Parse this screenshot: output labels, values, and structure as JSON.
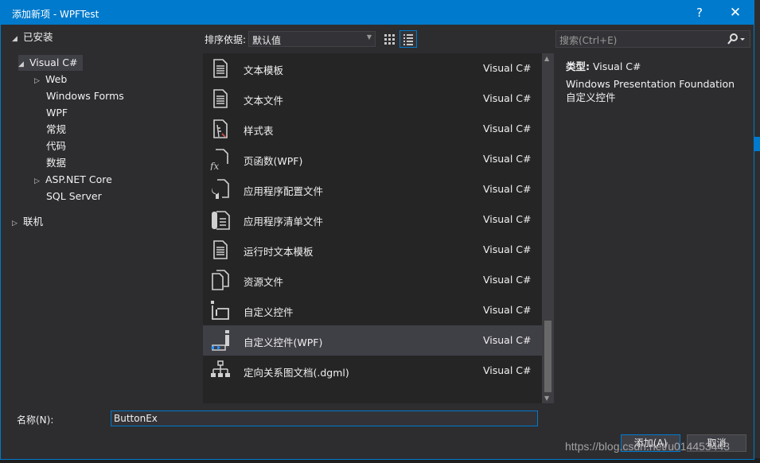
{
  "window": {
    "title": "添加新项 - WPFTest",
    "help": "?",
    "close": "✕"
  },
  "tree": {
    "installed": "已安装",
    "visual_csharp": "Visual C#",
    "web": "Web",
    "windows_forms": "Windows Forms",
    "wpf": "WPF",
    "general": "常规",
    "code": "代码",
    "data": "数据",
    "aspnet_core": "ASP.NET Core",
    "sql_server": "SQL Server",
    "online": "联机"
  },
  "toolbar": {
    "sort_label": "排序依据:",
    "sort_value": "默认值",
    "search_placeholder": "搜索(Ctrl+E)"
  },
  "items": [
    {
      "name": "文本模板",
      "lang": "Visual C#",
      "icon": "text-template-icon"
    },
    {
      "name": "文本文件",
      "lang": "Visual C#",
      "icon": "text-file-icon"
    },
    {
      "name": "样式表",
      "lang": "Visual C#",
      "icon": "stylesheet-icon"
    },
    {
      "name": "页函数(WPF)",
      "lang": "Visual C#",
      "icon": "page-function-icon"
    },
    {
      "name": "应用程序配置文件",
      "lang": "Visual C#",
      "icon": "config-file-icon"
    },
    {
      "name": "应用程序清单文件",
      "lang": "Visual C#",
      "icon": "manifest-file-icon"
    },
    {
      "name": "运行时文本模板",
      "lang": "Visual C#",
      "icon": "runtime-template-icon"
    },
    {
      "name": "资源文件",
      "lang": "Visual C#",
      "icon": "resource-file-icon"
    },
    {
      "name": "自定义控件",
      "lang": "Visual C#",
      "icon": "custom-control-icon"
    },
    {
      "name": "自定义控件(WPF)",
      "lang": "Visual C#",
      "icon": "wpf-custom-control-icon"
    },
    {
      "name": "定向关系图文档(.dgml)",
      "lang": "Visual C#",
      "icon": "dgml-icon"
    }
  ],
  "details": {
    "type_label": "类型:",
    "type_value": "Visual C#",
    "description": "Windows Presentation Foundation 自定义控件"
  },
  "name_field": {
    "label": "名称(N):",
    "value": "ButtonEx"
  },
  "buttons": {
    "add": "添加(A)",
    "cancel": "取消"
  },
  "watermark": "https://blog.csdn.net/u014453443",
  "colors": {
    "accent": "#007acc",
    "background": "#2d2d30",
    "list_background": "#252526",
    "selected": "#3f3f46"
  }
}
